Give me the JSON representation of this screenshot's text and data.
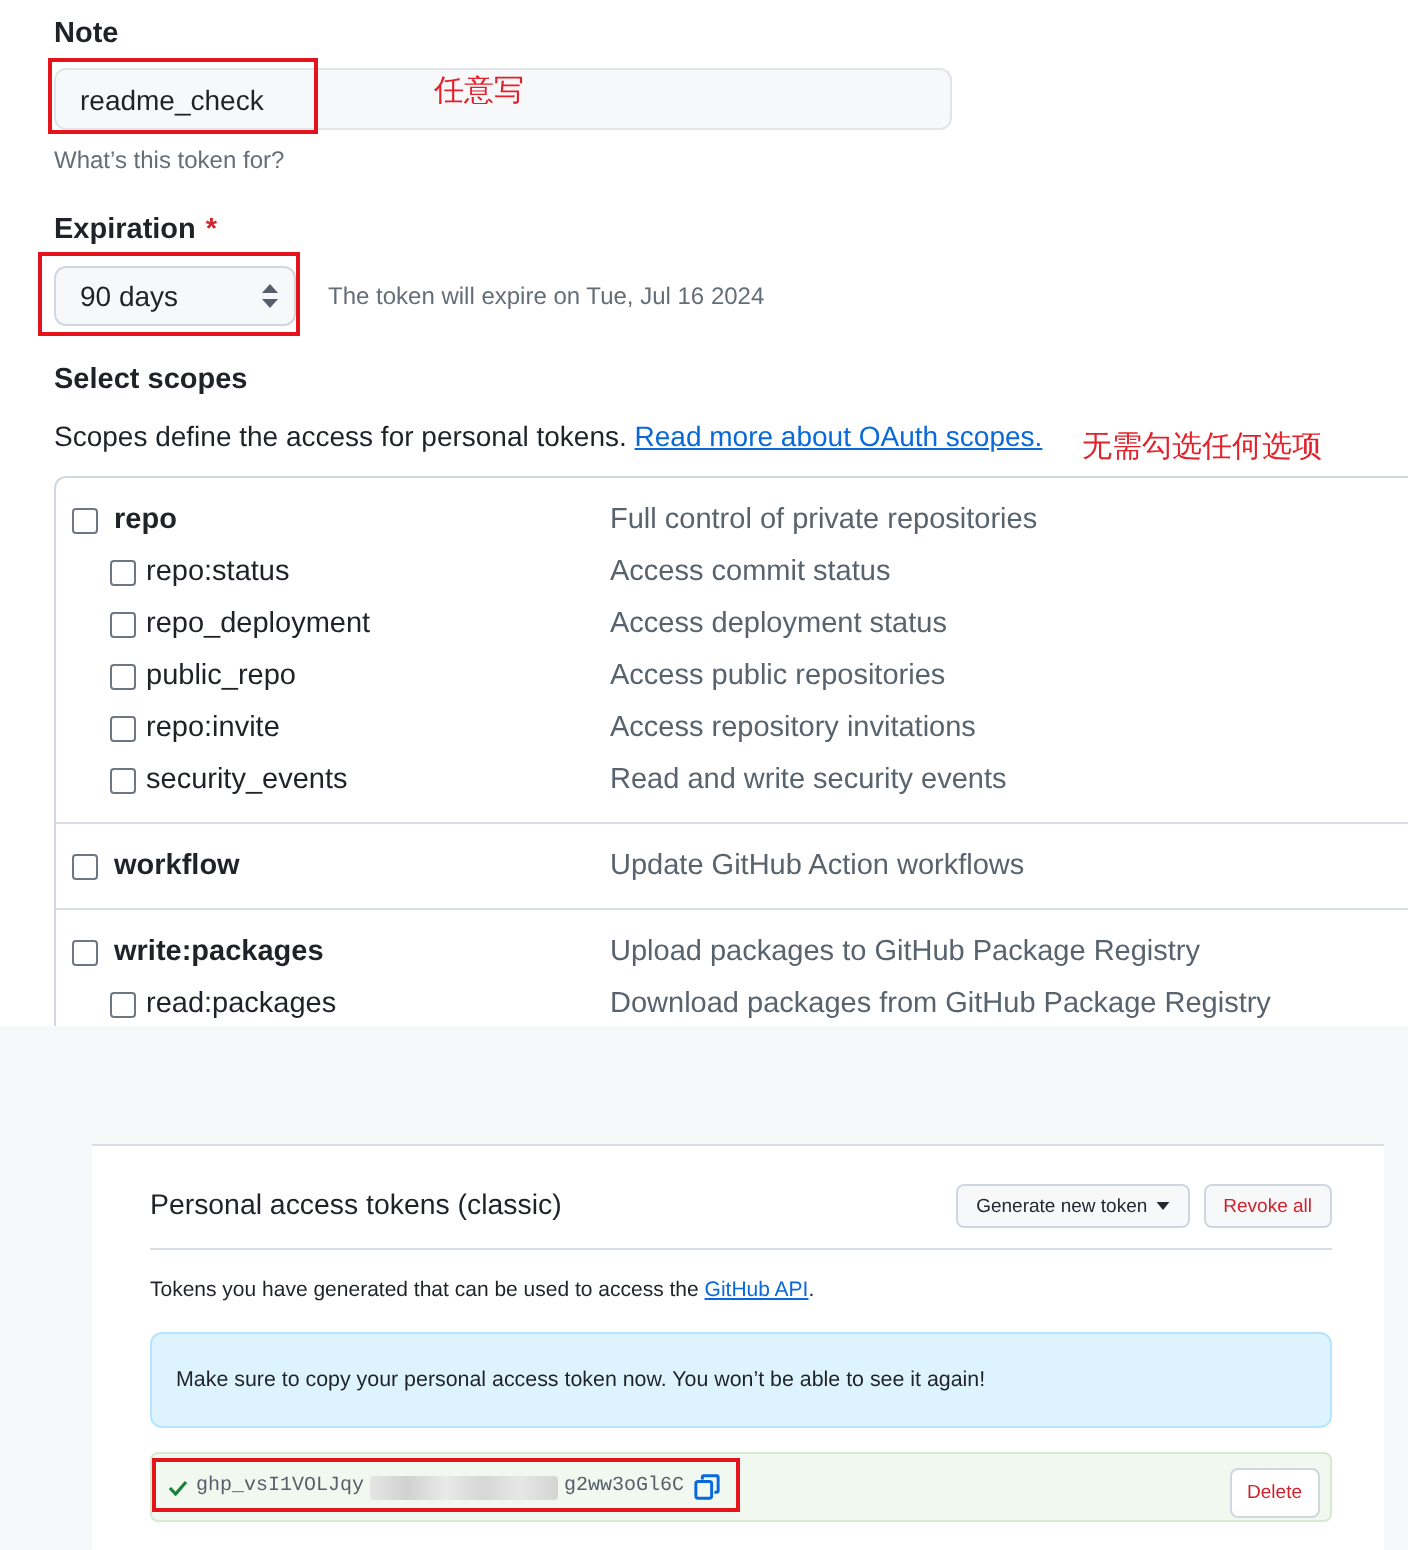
{
  "note": {
    "label": "Note",
    "value": "readme_check",
    "highlighted": true,
    "annotation": "任意写",
    "hint": "What’s this token for?"
  },
  "expiration": {
    "label": "Expiration",
    "required_mark": "*",
    "value": "90 days",
    "highlighted": true,
    "info": "The token will expire on Tue, Jul 16 2024"
  },
  "scopes": {
    "title": "Select scopes",
    "description": "Scopes define the access for personal tokens.",
    "link": "Read more about OAuth scopes.",
    "annotation": "无需勾选任何选项",
    "groups": [
      {
        "name": "repo",
        "description": "Full control of private repositories",
        "checked": false,
        "children": [
          {
            "name": "repo:status",
            "description": "Access commit status",
            "checked": false
          },
          {
            "name": "repo_deployment",
            "description": "Access deployment status",
            "checked": false
          },
          {
            "name": "public_repo",
            "description": "Access public repositories",
            "checked": false
          },
          {
            "name": "repo:invite",
            "description": "Access repository invitations",
            "checked": false
          },
          {
            "name": "security_events",
            "description": "Read and write security events",
            "checked": false
          }
        ]
      },
      {
        "name": "workflow",
        "description": "Update GitHub Action workflows",
        "checked": false
      },
      {
        "name": "write:packages",
        "description": "Upload packages to GitHub Package Registry",
        "checked": false,
        "children": [
          {
            "name": "read:packages",
            "description": "Download packages from GitHub Package Registry",
            "checked": false
          }
        ]
      }
    ]
  },
  "tokens": {
    "title": "Personal access tokens (classic)",
    "buttons": [
      {
        "label": "Generate new token",
        "kind": "menu"
      },
      {
        "label": "Revoke all",
        "kind": "danger"
      }
    ],
    "description": "Tokens you have generated that can be used to access the",
    "link": "GitHub API",
    "description_end": ".",
    "flash": "Make sure to copy your personal access token now. You won’t be able to see it again!",
    "token": {
      "prefix": "ghp_vsI1VOLJqy",
      "suffix": "g2ww3oGl6C",
      "highlighted": true,
      "delete_label": "Delete"
    }
  }
}
